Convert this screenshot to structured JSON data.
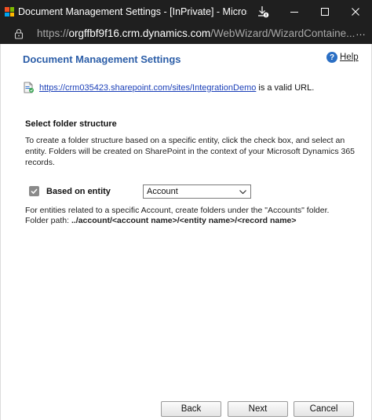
{
  "window": {
    "title": "Document Management Settings - [InPrivate] - Microsoft...",
    "url_scheme": "https://",
    "url_host": "orgffbf9f16.crm.dynamics.com",
    "url_path": "/WebWizard/WizardContaine..."
  },
  "colors": {
    "titlebar_bg": "#1f1f1f",
    "heading": "#2c5ea8",
    "link": "#1a3fb8",
    "logo_red": "#f25022",
    "logo_green": "#7fba00",
    "logo_blue": "#00a4ef",
    "logo_yellow": "#ffb900"
  },
  "icons": {
    "download": "download-icon",
    "minimize": "minimize-icon",
    "maximize": "maximize-icon",
    "close": "close-icon",
    "lock": "lock-icon",
    "help": "help-icon",
    "document": "document-icon",
    "checkmark": "checkmark-icon",
    "dropdown": "chevron-down-icon"
  },
  "page": {
    "heading": "Document Management Settings",
    "help_label": "Help",
    "help_glyph": "?",
    "valid_link": "https://crm035423.sharepoint.com/sites/IntegrationDemo",
    "valid_suffix": "is a valid URL.",
    "section_title": "Select folder structure",
    "description": "To create a folder structure based on a specific entity, click the check box, and select an entity. Folders will be created on SharePoint in the context of your Microsoft Dynamics 365 records.",
    "checkbox_label": "Based on entity",
    "checkbox_checked": true,
    "entity_selected": "Account",
    "note": "For entities related to a specific Account, create folders under the \"Accounts\" folder.",
    "path_label": "Folder path:",
    "path_value": "../account/<account name>/<entity name>/<record name>"
  },
  "buttons": {
    "back": "Back",
    "next": "Next",
    "cancel": "Cancel"
  }
}
